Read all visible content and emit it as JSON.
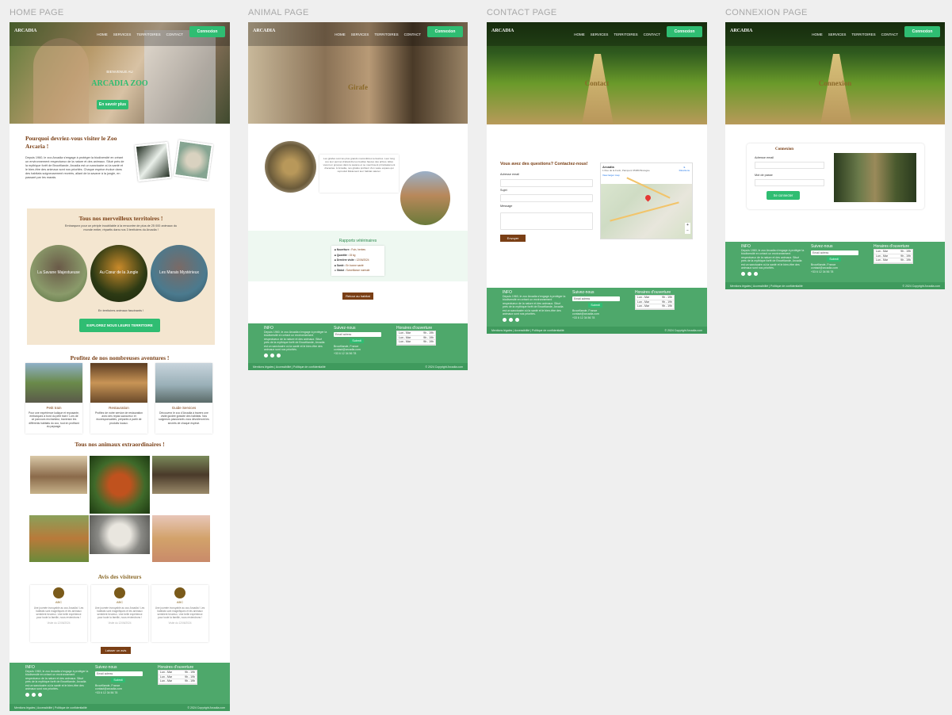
{
  "frames": {
    "home": "HOME PAGE",
    "animal": "ANIMAL PAGE",
    "contact": "CONTACT PAGE",
    "connexion": "CONNEXION PAGE"
  },
  "nav": {
    "logo": "ARCADIA",
    "links": [
      "HOME",
      "SERVICES",
      "TERRITOIRES",
      "CONTACT"
    ],
    "login": "Connexion"
  },
  "home": {
    "welcome": "BIENVENUE AU",
    "hero_title": "ARCADIA ZOO",
    "hero_button": "En savoir plus",
    "why_title": "Pourquoi devriez-vous visiter le Zoo Arcaria !",
    "why_text": "Depuis 1960, le zoo Arcadia s'engage à protéger la biodiversité en créant un environnement respectueux de la nature et des animaux. Situé près de la mythique forêt de Brocéliande, Arcadia est un sanctuaire où la santé et le bien-être des animaux sont nos priorités. Chaque espèce évolue dans des habitats soigneusement recréés, allant de la savane à la jungle, en passant par les marais.",
    "territories_title": "Tous nos merveilleux territoires !",
    "territories_sub": "Embarquez pour un périple inoubliable à la rencontre de plus de 25 000 animaux du monde entier, répartis dans nos 3 territoires du Arcadia !",
    "territories": [
      "La Savane Majestueuse",
      "Au Cœur de la Jungle",
      "Les Marais Mystérieux"
    ],
    "territories_note": "En territoires animaux fascinants !",
    "territories_button": "EXPLOREZ NOUS LEURS TERRITOIRE",
    "adventures_title": "Profitez de nos nombreuses aventures !",
    "services": [
      {
        "name": "Petit train",
        "text": "Pour une expérience ludique et reposante, embarquez à bord du petit train ! Lors de ce parcours enchanteur, traversez les différents habitats du zoo, tout en profitant du paysage."
      },
      {
        "name": "Restauration",
        "text": "Profitez de notre service de restauration avec des repas savoureux et écoresponsables, préparés à partir de produits locaux."
      },
      {
        "name": "Guide Services",
        "text": "Découvrez le zoo d'Arcadia à travers une visite guidée gratuite des habitats. Nos soigneurs passionnés vous dévoileront les secrets de chaque espèce."
      }
    ],
    "animals_title": "Tous nos animaux extraordinaires !",
    "reviews_title": "Avis des visiteurs",
    "reviews": [
      {
        "name": "ABC",
        "text": "Une journée incroyable au zoo Arcadia ! Les habitats sont magnifiques et les animaux semblent heureux. Une belle expérience pour toute la famille, nous reviendrons !",
        "date": "Visite du 12/06/2024"
      },
      {
        "name": "ABC",
        "text": "Une journée incroyable au zoo Arcadia ! Les habitats sont magnifiques et les animaux semblent heureux. Une belle expérience pour toute la famille, nous reviendrons !",
        "date": "Visite du 12/06/2024"
      },
      {
        "name": "ABC",
        "text": "Une journée incroyable au zoo Arcadia ! Les habitats sont magnifiques et les animaux semblent heureux. Une belle expérience pour toute la famille, nous reviendrons !",
        "date": "Visite du 12/06/2024"
      }
    ],
    "review_button": "Laisser un avis"
  },
  "animal": {
    "hero_title": "Girafe",
    "description": "Les girafes sont les plus grands mammifères terrestres. Leur long cou leur permet d'atteindre les feuilles hautes des arbres. Elles vivent en groupes dans la savane et se nourrissent principalement d'acacias. À Arcadia, nos girafes profitent d'un vaste espace qui reproduit fidèlement leur habitat naturel.",
    "vet_title": "Rapports vétérinaires",
    "vet_items": [
      {
        "label": "Nourriture :",
        "value": "Foin, herbes"
      },
      {
        "label": "Quantité :",
        "value": "15 kg"
      },
      {
        "label": "Dernière visite :",
        "value": "12/06/2024"
      },
      {
        "label": "Santé :",
        "value": "En bonne santé"
      },
      {
        "label": "Statut :",
        "value": "Surveillance normale"
      }
    ],
    "back_button": "Retour au habitat"
  },
  "contact": {
    "hero_title": "Contact",
    "form_title": "Vous avez des questions? Contactez-nous!",
    "email_label": "Adresse email",
    "subject_label": "Sujet",
    "message_label": "Message",
    "send_button": "Envoyer",
    "map_title": "Arcadia",
    "map_address": "1 Rue de la Forêt, Paimpont 35380 Bretagne",
    "map_link": "View larger map",
    "map_directions": "Directions"
  },
  "connexion": {
    "hero_title": "Connexion",
    "form_title": "Connexion",
    "email_label": "Adresse email",
    "password_label": "Mot de passe",
    "button": "Se connecter"
  },
  "footer": {
    "info_title": "INFO",
    "info_text": "Depuis 1960, le zoo Arcadia s'engage à protéger la biodiversité en créant un environnement respectueux de la nature et des animaux. Situé près de la mythique forêt de Brocéliande, Arcadia est un sanctuaire où la santé et le bien-être des animaux sont nos priorités.",
    "follow_title": "Suivez-nous",
    "email_placeholder": "Email adress",
    "submit": "Submit",
    "location": "Brocéliande, France",
    "email": "contact@arcadia.com",
    "phone": "+33 6 12 34 56 78",
    "hours_title": "Horaires d'ouverture",
    "hours": [
      {
        "day": "Lun - Mar",
        "time": "9h - 19h"
      },
      {
        "day": "Lun - Mar",
        "time": "9h - 19h"
      },
      {
        "day": "Lun - Mar",
        "time": "9h - 19h"
      }
    ],
    "legal": "Mentions légales | Accessibilité | Politique de confidentialité",
    "copyright": "© 2024 Copyright Arcadia.com"
  },
  "colors": {
    "green": "#4ea86b",
    "button_green": "#2fbd72",
    "brown": "#7a3f15",
    "gold": "#8b6a2a"
  }
}
